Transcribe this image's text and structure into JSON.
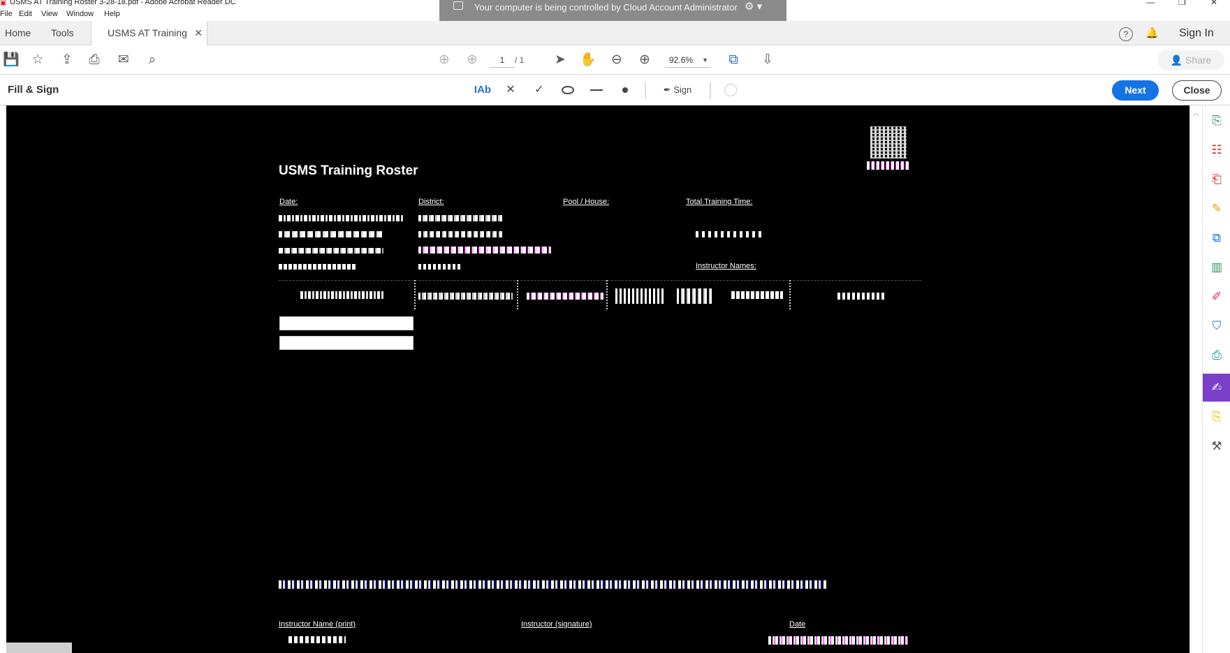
{
  "window": {
    "title": "USMS AT Training Roster 3-28-18.pdf - Adobe Acrobat Reader DC",
    "controls": [
      "—",
      "❐",
      "✕"
    ]
  },
  "menu": [
    "File",
    "Edit",
    "View",
    "Window",
    "Help"
  ],
  "banner": {
    "text": "Your computer is being controlled by Cloud Account Administrator",
    "gear": "⚙ ▾"
  },
  "tabs": {
    "home": "Home",
    "tools": "Tools",
    "doc": "USMS AT Training R...",
    "close": "✕"
  },
  "tabbar_right": {
    "help": "?",
    "bell": "🔔",
    "sign_in": "Sign In"
  },
  "toolbar": {
    "page_current": "1",
    "page_total": "/ 1",
    "zoom": "92.6%",
    "zoom_caret": "▼",
    "share": "Share"
  },
  "fill_sign": {
    "title": "Fill & Sign",
    "text_tool": "IAb",
    "cross": "✕",
    "check": "✓",
    "sign": "Sign",
    "next": "Next",
    "close": "Close"
  },
  "pdf": {
    "title": "USMS Training Roster",
    "labels": {
      "date": "Date:",
      "district": "District:",
      "pool_house": "Pool / House:",
      "total_training_time": "Total Training Time:",
      "instructor_names": "Instructor Names:",
      "instructor_name_print": "Instructor Name (print)",
      "instructor_signature": "Instructor (signature)",
      "date_bottom": "Date"
    }
  },
  "colors": {
    "accent": "#1473e6",
    "fill_sign_active": "#7b3fc9",
    "banner": "#8a8a8a"
  }
}
